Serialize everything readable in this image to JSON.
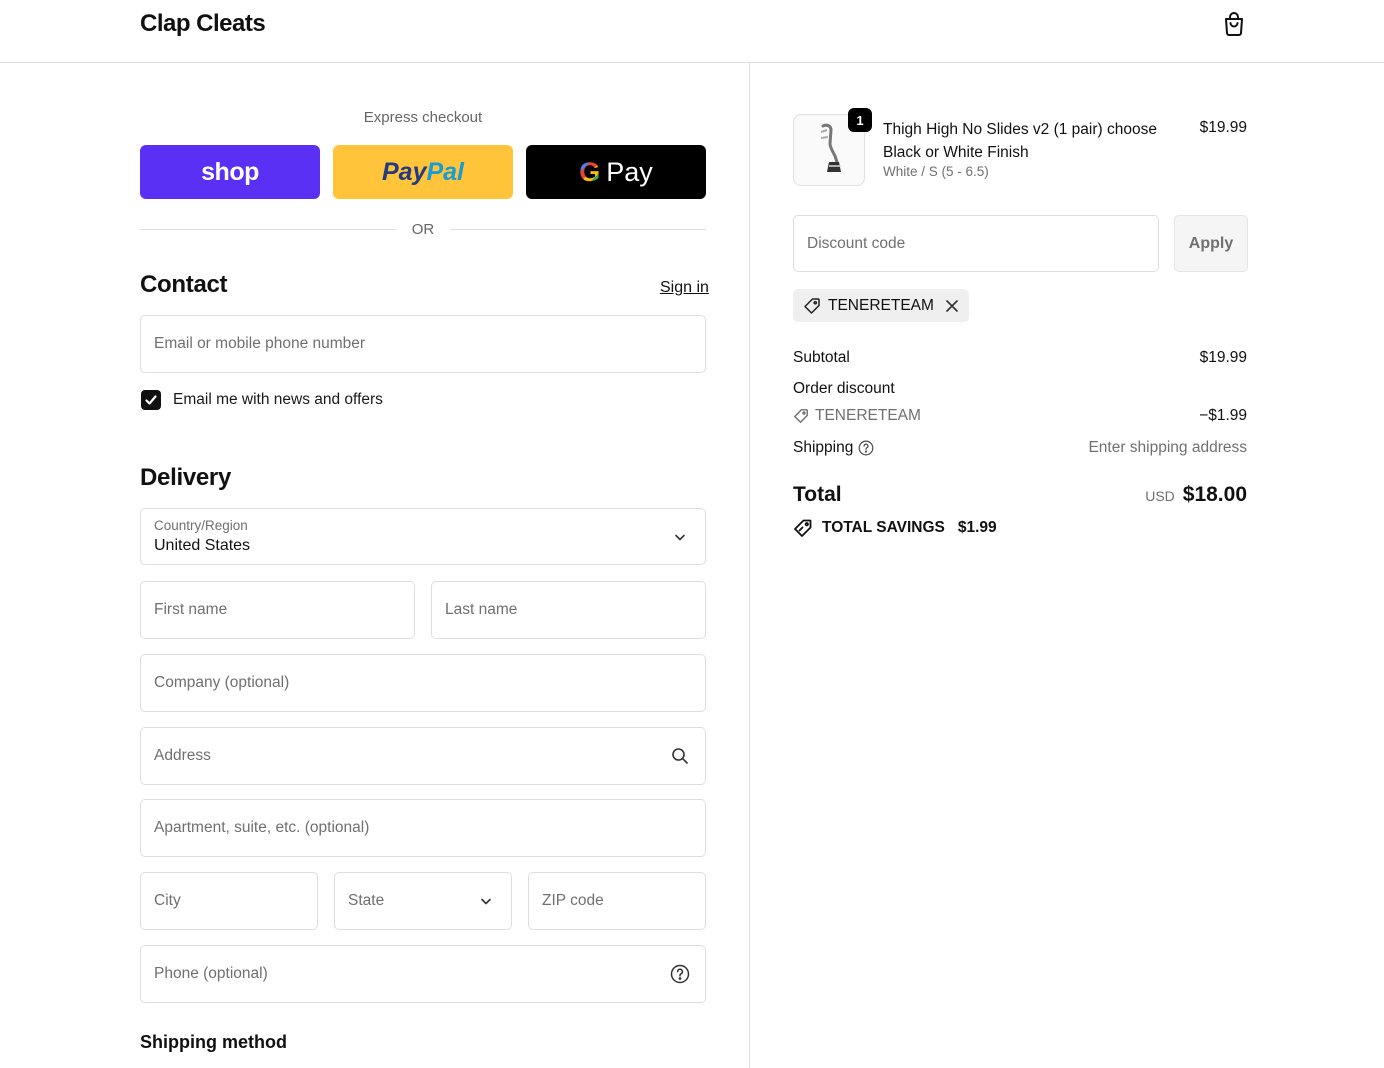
{
  "header": {
    "brand": "Clap Cleats",
    "cart_icon": "shopping-bag-icon"
  },
  "express": {
    "title": "Express checkout",
    "shop_label": "shop",
    "paypal_label_a": "Pay",
    "paypal_label_b": "Pal",
    "gpay_g": "G",
    "gpay_label": "Pay",
    "or_label": "OR"
  },
  "contact": {
    "heading": "Contact",
    "sign_in": "Sign in",
    "email_placeholder": "Email or mobile phone number",
    "newsletter_checked": true,
    "newsletter_label": "Email me with news and offers"
  },
  "delivery": {
    "heading": "Delivery",
    "country_label": "Country/Region",
    "country_value": "United States",
    "first_name": "First name",
    "last_name": "Last name",
    "company": "Company (optional)",
    "address": "Address",
    "apartment": "Apartment, suite, etc. (optional)",
    "city": "City",
    "state": "State",
    "zip": "ZIP code",
    "phone": "Phone (optional)"
  },
  "shipping_method": {
    "heading": "Shipping method"
  },
  "cart": {
    "item": {
      "quantity": "1",
      "title": "Thigh High No Slides v2 (1 pair) choose Black or White Finish",
      "variant": "White / S (5 - 6.5)",
      "price": "$19.99"
    },
    "discount_placeholder": "Discount code",
    "apply_label": "Apply",
    "applied_code": "TENERETEAM"
  },
  "summary": {
    "subtotal_label": "Subtotal",
    "subtotal_value": "$19.99",
    "order_discount_label": "Order discount",
    "discount_code": "TENERETEAM",
    "discount_value": "−$1.99",
    "shipping_label": "Shipping",
    "shipping_value": "Enter shipping address",
    "total_label": "Total",
    "currency": "USD",
    "total_value": "$18.00",
    "savings_label": "TOTAL SAVINGS",
    "savings_value": "$1.99"
  },
  "colors": {
    "shop_purple": "#5a31f4",
    "paypal_yellow": "#ffc439",
    "gpay_black": "#000000",
    "border": "#dedede"
  }
}
